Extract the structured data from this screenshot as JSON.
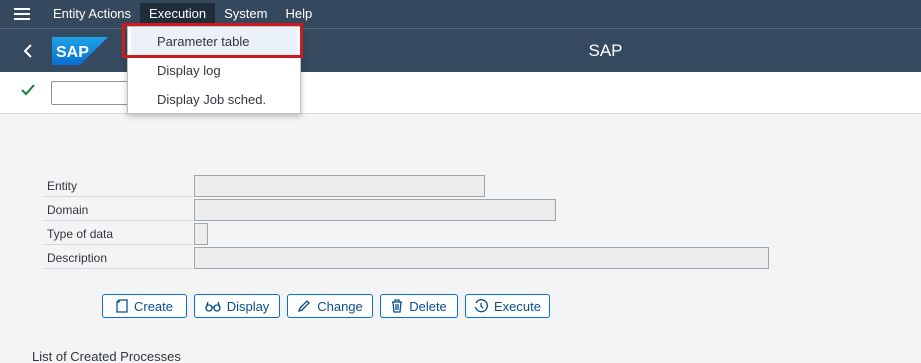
{
  "menubar": {
    "items": [
      {
        "label": "Entity Actions"
      },
      {
        "label": "Execution"
      },
      {
        "label": "System"
      },
      {
        "label": "Help"
      }
    ]
  },
  "titlebar": {
    "logo_text": "SAP",
    "title": "SAP"
  },
  "dropdown": {
    "items": [
      {
        "label": "Parameter table"
      },
      {
        "label": "Display log"
      },
      {
        "label": "Display Job sched."
      }
    ]
  },
  "form": {
    "fields": [
      {
        "label": "Entity",
        "value": ""
      },
      {
        "label": "Domain",
        "value": ""
      },
      {
        "label": "Type of data",
        "value": ""
      },
      {
        "label": "Description",
        "value": ""
      }
    ]
  },
  "buttons": {
    "create": "Create",
    "display": "Display",
    "change": "Change",
    "delete": "Delete",
    "execute": "Execute"
  },
  "list": {
    "title": "List of Created Processes"
  },
  "colors": {
    "shell": "#34495e",
    "accent": "#0a6ed1",
    "highlight": "#d0181f",
    "check": "#107e3e"
  }
}
